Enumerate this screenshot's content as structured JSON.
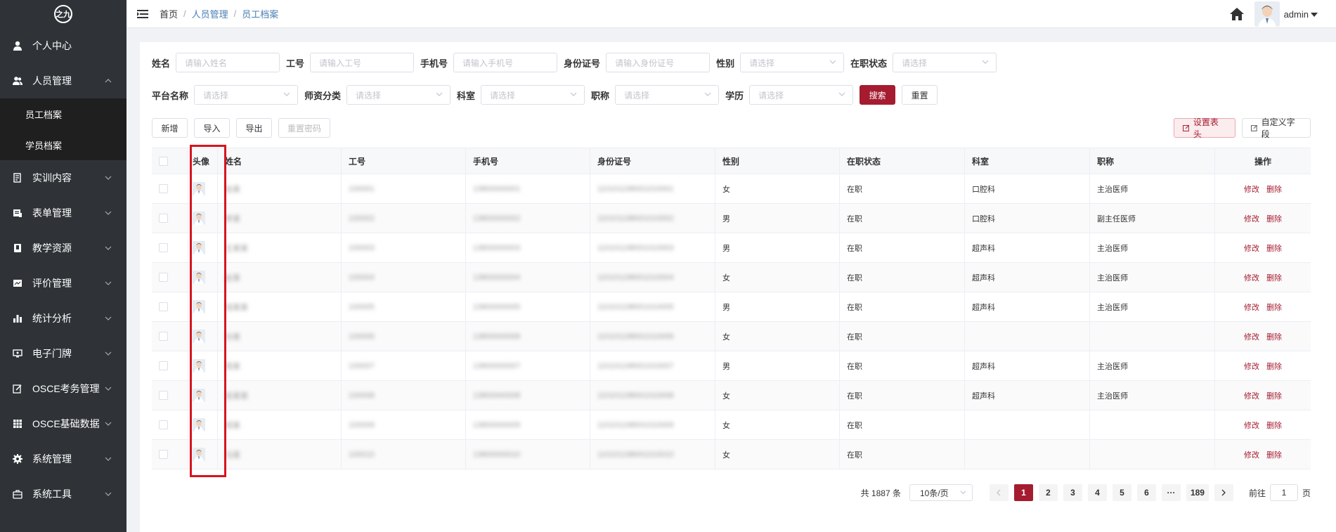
{
  "logo": {
    "text": "之九"
  },
  "sidebar": {
    "items": [
      {
        "label": "个人中心",
        "icon": "user-icon",
        "expandable": false
      },
      {
        "label": "人员管理",
        "icon": "users-icon",
        "expandable": true,
        "expanded": true,
        "children": [
          {
            "label": "员工档案",
            "active": true
          },
          {
            "label": "学员档案",
            "active": false
          }
        ]
      },
      {
        "label": "实训内容",
        "icon": "training-icon",
        "expandable": true
      },
      {
        "label": "表单管理",
        "icon": "form-icon",
        "expandable": true
      },
      {
        "label": "教学资源",
        "icon": "book-icon",
        "expandable": true
      },
      {
        "label": "评价管理",
        "icon": "evaluate-icon",
        "expandable": true
      },
      {
        "label": "统计分析",
        "icon": "bar-chart-icon",
        "expandable": true
      },
      {
        "label": "电子门牌",
        "icon": "monitor-icon",
        "expandable": true
      },
      {
        "label": "OSCE考务管理",
        "icon": "edit-icon",
        "expandable": true
      },
      {
        "label": "OSCE基础数据",
        "icon": "grid-icon",
        "expandable": true
      },
      {
        "label": "系统管理",
        "icon": "gear-icon",
        "expandable": true
      },
      {
        "label": "系统工具",
        "icon": "briefcase-icon",
        "expandable": true
      }
    ]
  },
  "header": {
    "breadcrumb": [
      "首页",
      "人员管理",
      "员工档案"
    ],
    "user": "admin"
  },
  "filters": {
    "row1": [
      {
        "label": "姓名",
        "placeholder": "请输入姓名",
        "type": "input"
      },
      {
        "label": "工号",
        "placeholder": "请输入工号",
        "type": "input"
      },
      {
        "label": "手机号",
        "placeholder": "请输入手机号",
        "type": "input"
      },
      {
        "label": "身份证号",
        "placeholder": "请输入身份证号",
        "type": "input"
      },
      {
        "label": "性别",
        "placeholder": "请选择",
        "type": "select"
      },
      {
        "label": "在职状态",
        "placeholder": "请选择",
        "type": "select"
      }
    ],
    "row2": [
      {
        "label": "平台名称",
        "placeholder": "请选择",
        "type": "select"
      },
      {
        "label": "师资分类",
        "placeholder": "请选择",
        "type": "select"
      },
      {
        "label": "科室",
        "placeholder": "请选择",
        "type": "select"
      },
      {
        "label": "职称",
        "placeholder": "请选择",
        "type": "select"
      },
      {
        "label": "学历",
        "placeholder": "请选择",
        "type": "select"
      }
    ],
    "search_label": "搜索",
    "reset_label": "重置"
  },
  "toolbar": {
    "add": "新增",
    "import": "导入",
    "export": "导出",
    "reset_password": "重置密码",
    "set_header": "设置表头",
    "custom_field": "自定义字段"
  },
  "table": {
    "columns": [
      "头像",
      "姓名",
      "工号",
      "手机号",
      "身份证号",
      "性别",
      "在职状态",
      "科室",
      "职称",
      "操作"
    ],
    "edit_label": "修改",
    "delete_label": "删除",
    "rows": [
      {
        "name": "张某",
        "no": "100001",
        "phone": "13800000001",
        "id": "110101198001010001",
        "gender": "女",
        "status": "在职",
        "dept": "口腔科",
        "title": "主治医师"
      },
      {
        "name": "李某",
        "no": "100002",
        "phone": "13800000002",
        "id": "110101198001010002",
        "gender": "男",
        "status": "在职",
        "dept": "口腔科",
        "title": "副主任医师"
      },
      {
        "name": "王某某",
        "no": "100003",
        "phone": "13800000003",
        "id": "110101198001010003",
        "gender": "男",
        "status": "在职",
        "dept": "超声科",
        "title": "主治医师"
      },
      {
        "name": "赵某",
        "no": "100004",
        "phone": "13800000004",
        "id": "110101198001010004",
        "gender": "女",
        "status": "在职",
        "dept": "超声科",
        "title": "主治医师"
      },
      {
        "name": "钱某某",
        "no": "100005",
        "phone": "13800000005",
        "id": "110101198001010005",
        "gender": "男",
        "status": "在职",
        "dept": "超声科",
        "title": "主治医师"
      },
      {
        "name": "孙某",
        "no": "100006",
        "phone": "13800000006",
        "id": "110101198001010006",
        "gender": "女",
        "status": "在职",
        "dept": "",
        "title": ""
      },
      {
        "name": "周某",
        "no": "100007",
        "phone": "13800000007",
        "id": "110101198001010007",
        "gender": "男",
        "status": "在职",
        "dept": "超声科",
        "title": "主治医师"
      },
      {
        "name": "吴某某",
        "no": "100008",
        "phone": "13800000008",
        "id": "110101198001010008",
        "gender": "女",
        "status": "在职",
        "dept": "超声科",
        "title": "主治医师"
      },
      {
        "name": "郑某",
        "no": "100009",
        "phone": "13800000009",
        "id": "110101198001010009",
        "gender": "女",
        "status": "在职",
        "dept": "",
        "title": ""
      },
      {
        "name": "冯某",
        "no": "100010",
        "phone": "13800000010",
        "id": "110101198001010010",
        "gender": "女",
        "status": "在职",
        "dept": "",
        "title": ""
      }
    ]
  },
  "pagination": {
    "total": "共 1887 条",
    "page_size": "10条/页",
    "pages": [
      "1",
      "2",
      "3",
      "4",
      "5",
      "6",
      "···",
      "189"
    ],
    "current": "1",
    "goto_prefix": "前往",
    "goto_value": "1",
    "goto_suffix": "页"
  },
  "colors": {
    "primary": "#a51c30",
    "sidebar_bg": "#2f3337",
    "highlight": "#d7141e"
  }
}
